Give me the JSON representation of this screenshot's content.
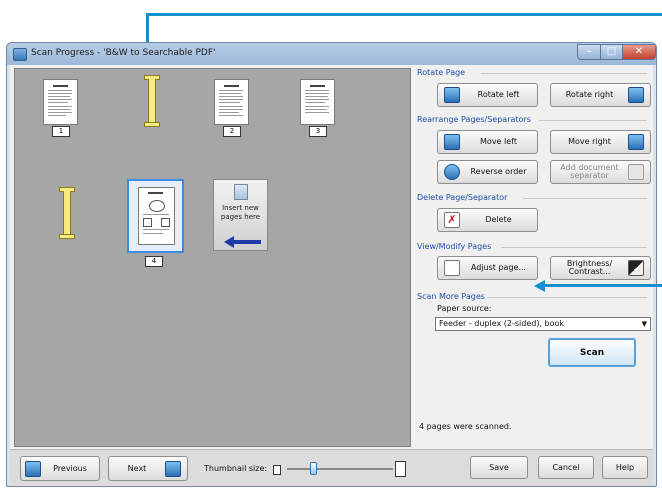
{
  "window": {
    "title": "Scan Progress - 'B&W to Searchable PDF'",
    "min_glyph": "–",
    "max_glyph": "□",
    "close_glyph": "✕"
  },
  "pages": {
    "labels": [
      "1",
      "2",
      "3",
      "4"
    ],
    "insert_card_label": "Insert new\npages here"
  },
  "rotate": {
    "title": "Rotate Page",
    "left_label": "Rotate left",
    "right_label": "Rotate right"
  },
  "rearrange": {
    "title": "Rearrange Pages/Separators",
    "move_left_label": "Move left",
    "move_right_label": "Move right",
    "reverse_order_label": "Reverse order",
    "add_separator_label": "Add document\nseparator"
  },
  "delete_section": {
    "title": "Delete Page/Separator",
    "delete_label": "Delete"
  },
  "view_modify": {
    "title": "View/Modify Pages",
    "adjust_label": "Adjust page...",
    "brightness_label": "Brightness/\nContrast..."
  },
  "scan_more": {
    "title": "Scan More Pages",
    "paper_source_label": "Paper source:",
    "paper_source_value": "Feeder - duplex (2-sided), book",
    "scan_label": "Scan"
  },
  "status": {
    "text": "4 pages were scanned."
  },
  "bottom": {
    "previous_label": "Previous",
    "next_label": "Next",
    "thumbnail_size_label": "Thumbnail size:",
    "thumbnail_size_level": 0.25,
    "save_label": "Save",
    "cancel_label": "Cancel",
    "help_label": "Help"
  },
  "colors": {
    "callout": "#1490d0",
    "separator": "#f6ea80",
    "section_title": "#1f4ea8",
    "selection": "#3b8de0"
  }
}
